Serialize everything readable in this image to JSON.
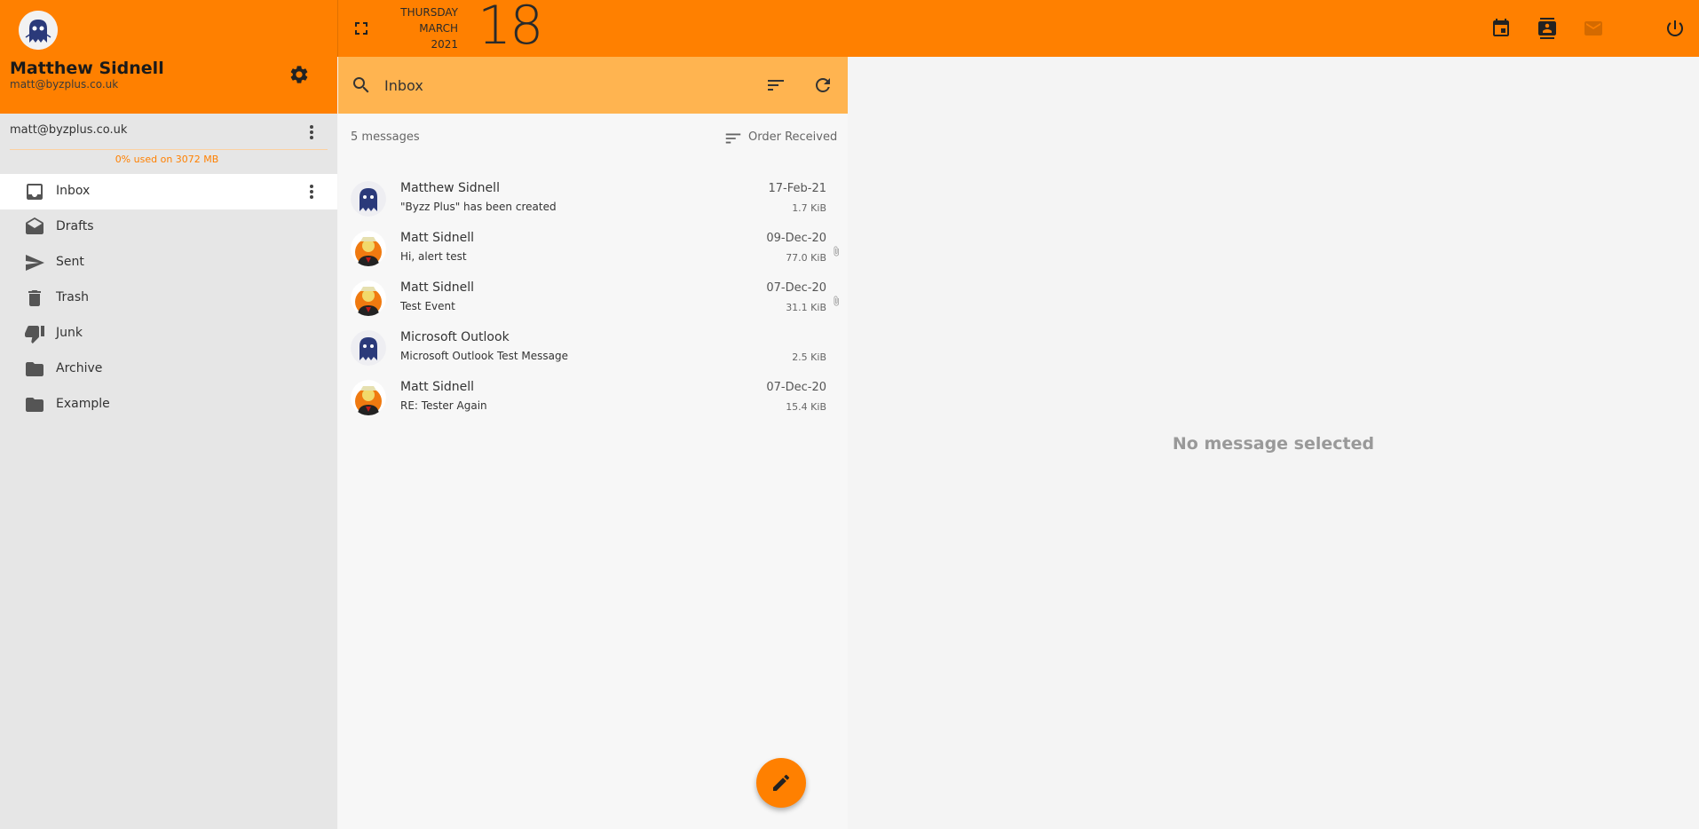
{
  "header": {
    "date": {
      "weekday": "THURSDAY",
      "month": "MARCH",
      "year": "2021",
      "day": "18"
    }
  },
  "account": {
    "name": "Matthew Sidnell",
    "email": "matt@byzplus.co.uk"
  },
  "sidebar": {
    "account_label": "matt@byzplus.co.uk",
    "quota": "0% used on 3072 MB",
    "folders": [
      {
        "label": "Inbox",
        "icon": "inbox-icon",
        "active": true
      },
      {
        "label": "Drafts",
        "icon": "drafts-icon"
      },
      {
        "label": "Sent",
        "icon": "send-icon"
      },
      {
        "label": "Trash",
        "icon": "trash-icon"
      },
      {
        "label": "Junk",
        "icon": "thumb-down-icon"
      },
      {
        "label": "Archive",
        "icon": "folder-icon"
      },
      {
        "label": "Example",
        "icon": "folder-icon"
      }
    ]
  },
  "list": {
    "search_value": "Inbox",
    "count": "5 messages",
    "sort_label": "Order Received",
    "messages": [
      {
        "sender": "Matthew Sidnell",
        "subject": "\"Byzz Plus\" has been created",
        "date": "17-Feb-21",
        "size": "1.7 KiB",
        "attachment": false
      },
      {
        "sender": "Matt Sidnell",
        "subject": "Hi, alert test",
        "date": "09-Dec-20",
        "size": "77.0 KiB",
        "attachment": true
      },
      {
        "sender": "Matt Sidnell",
        "subject": "Test Event",
        "date": "07-Dec-20",
        "size": "31.1 KiB",
        "attachment": true
      },
      {
        "sender": "Microsoft Outlook",
        "subject": "Microsoft Outlook Test Message",
        "date": "",
        "size": "2.5 KiB",
        "attachment": false
      },
      {
        "sender": "Matt Sidnell",
        "subject": "RE: Tester Again",
        "date": "07-Dec-20",
        "size": "15.4 KiB",
        "attachment": false
      }
    ]
  },
  "preview": {
    "empty_text": "No message selected"
  },
  "colors": {
    "accent": "#ff8000",
    "search_bar": "#ffb450"
  }
}
